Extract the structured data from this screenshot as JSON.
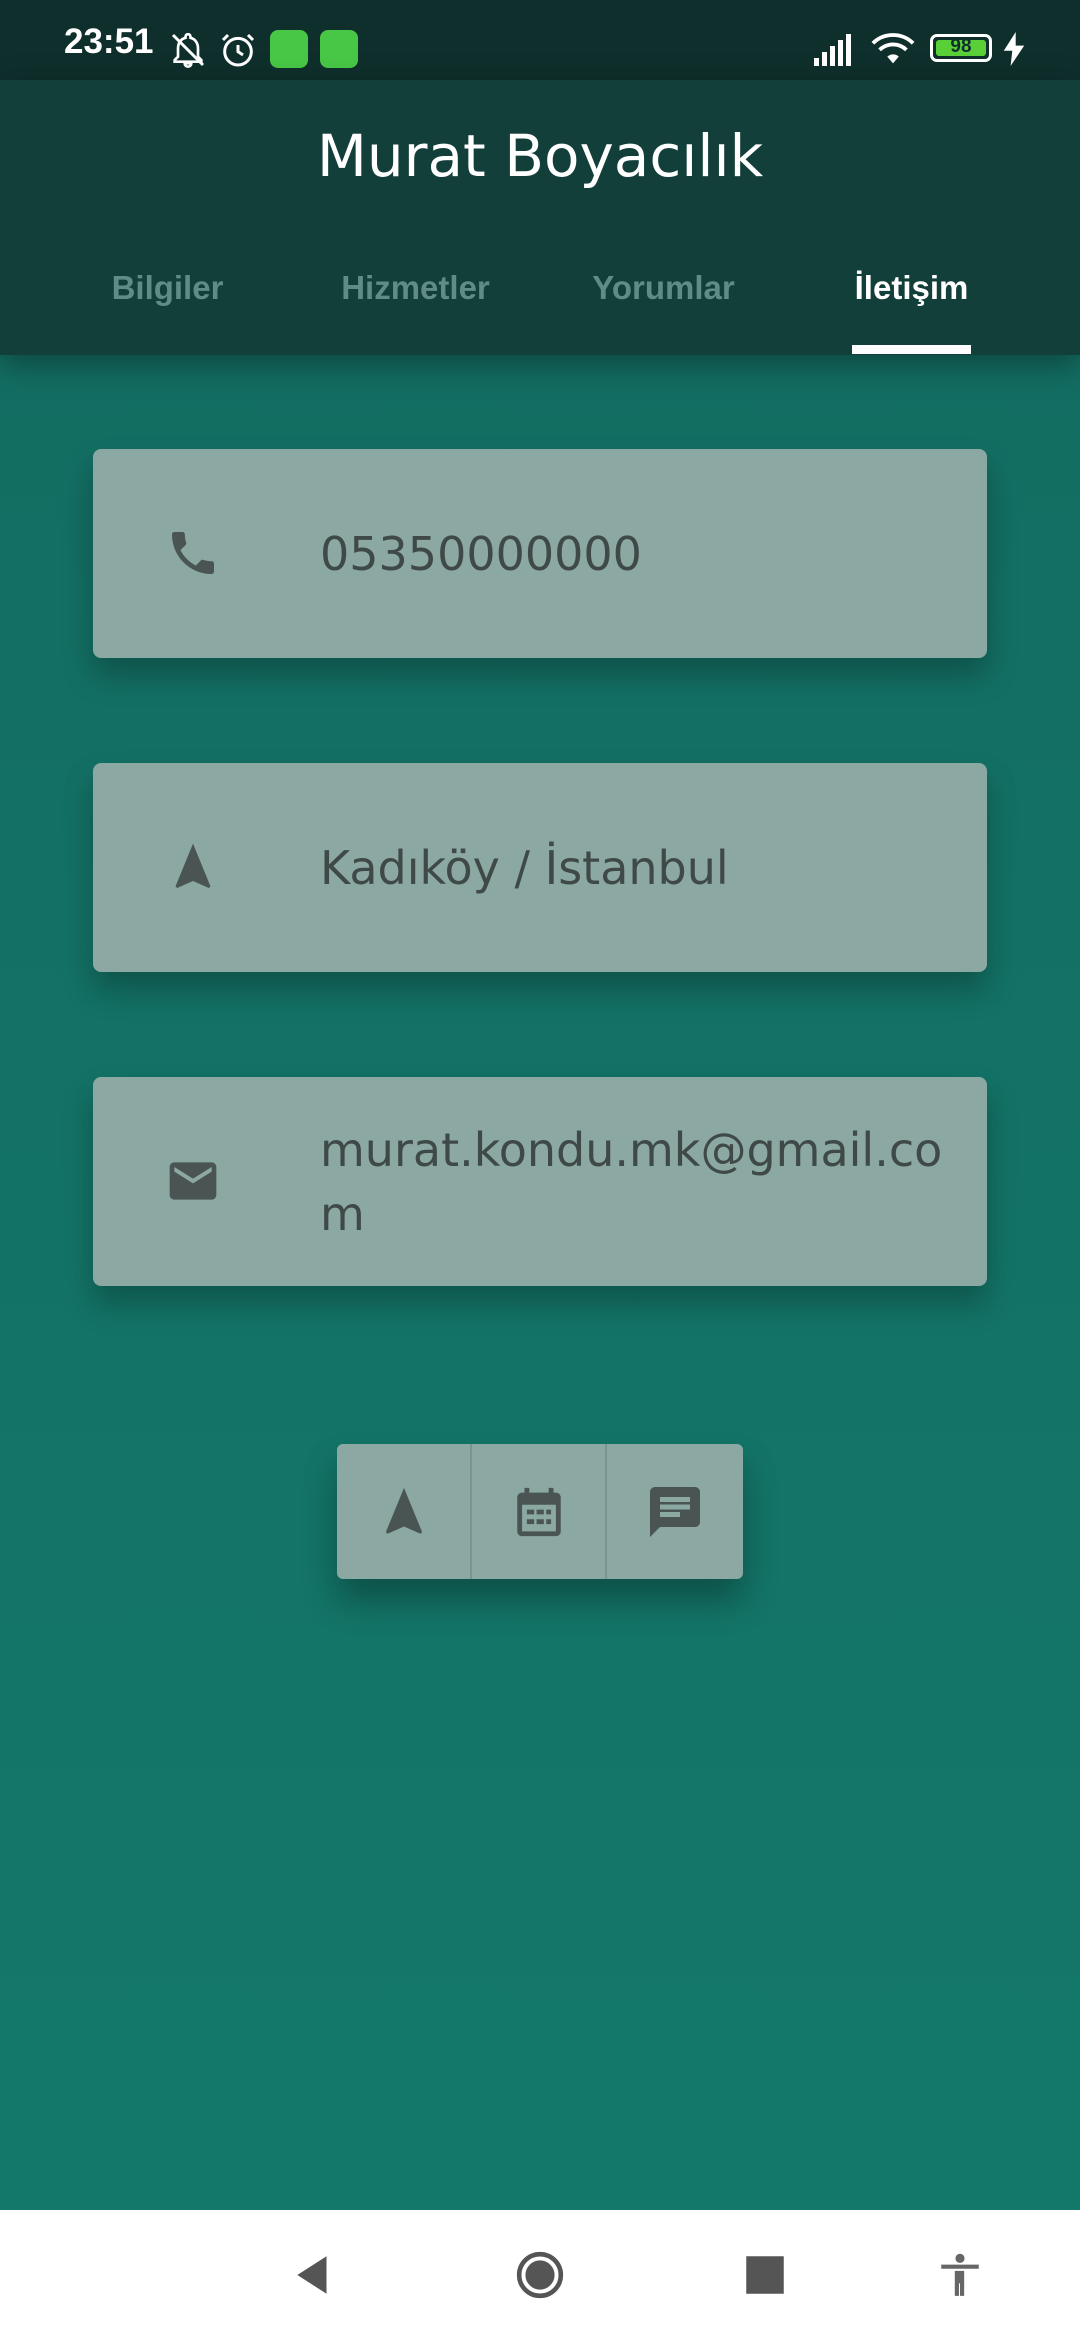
{
  "status_bar": {
    "time": "23:51",
    "battery": "98",
    "icons_left": [
      "mute-icon",
      "alarm-icon",
      "app-icon",
      "app-icon"
    ],
    "icons_right": [
      "signal-icon",
      "wifi-icon",
      "battery-icon",
      "charging-icon"
    ]
  },
  "header": {
    "title": "Murat Boyacılık",
    "tabs": [
      {
        "label": "Bilgiler"
      },
      {
        "label": "Hizmetler"
      },
      {
        "label": "Yorumlar"
      },
      {
        "label": "İletişim"
      }
    ],
    "active_tab": "İletişim"
  },
  "contact": {
    "phone": {
      "icon": "phone-icon",
      "value": "05350000000"
    },
    "location": {
      "icon": "navigation-icon",
      "value": "Kadıköy / İstanbul"
    },
    "email": {
      "icon": "mail-icon",
      "value": "murat.kondu.mk@gmail.com"
    }
  },
  "actions": [
    {
      "icon": "navigation-icon"
    },
    {
      "icon": "calendar-icon"
    },
    {
      "icon": "message-icon"
    }
  ],
  "nav_bar": {
    "buttons": [
      "back-icon",
      "home-icon",
      "recents-icon",
      "accessibility-icon"
    ]
  },
  "colors": {
    "header": "#133f3a",
    "background": "#17786b",
    "card": "#8ba8a3",
    "icon": "#4a5553"
  }
}
